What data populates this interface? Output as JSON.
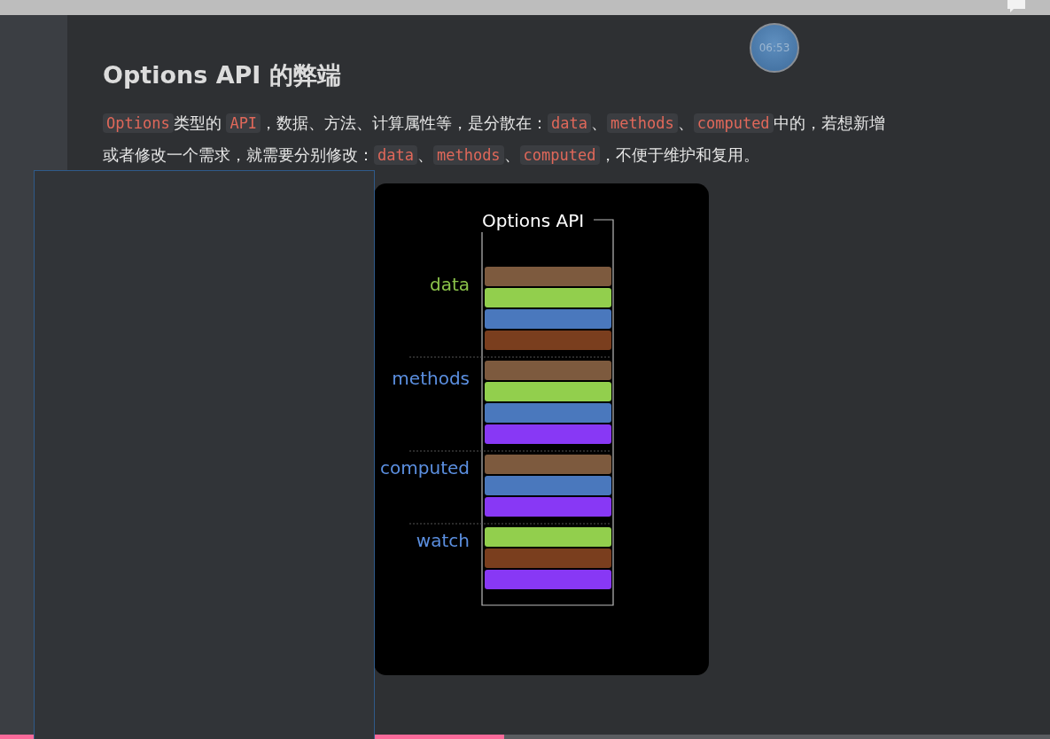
{
  "clock": "06:53",
  "heading": "Options API 的弊端",
  "paragraph": [
    [
      {
        "kind": "code",
        "text": "Options"
      },
      {
        "kind": "text",
        "text": "类型的 "
      },
      {
        "kind": "code",
        "text": "API"
      },
      {
        "kind": "text",
        "text": "，数据、方法、计算属性等，是分散在："
      },
      {
        "kind": "code",
        "text": "data"
      },
      {
        "kind": "text",
        "text": "、"
      },
      {
        "kind": "code",
        "text": "methods"
      },
      {
        "kind": "text",
        "text": "、"
      },
      {
        "kind": "code",
        "text": "computed"
      },
      {
        "kind": "text",
        "text": "中的，若想新增"
      }
    ],
    [
      {
        "kind": "text",
        "text": "或者修改一个需求，就需要分别修改："
      },
      {
        "kind": "code",
        "text": "data"
      },
      {
        "kind": "text",
        "text": "、"
      },
      {
        "kind": "code",
        "text": "methods"
      },
      {
        "kind": "text",
        "text": "、"
      },
      {
        "kind": "code",
        "text": "computed"
      },
      {
        "kind": "text",
        "text": "，不便于维护和复用。"
      }
    ]
  ],
  "diagram": {
    "title": "Options API",
    "groups": [
      {
        "label": "data",
        "color": "#8bc34a",
        "blocks": [
          {
            "color": "#7d5a3e"
          },
          {
            "color": "#92cf4d"
          },
          {
            "color": "#4a78bd"
          },
          {
            "color": "#7a3e1e"
          }
        ]
      },
      {
        "label": "methods",
        "color": "#5b8fe0",
        "blocks": [
          {
            "color": "#7d5a3e"
          },
          {
            "color": "#92cf4d"
          },
          {
            "color": "#4a78bd"
          },
          {
            "color": "#8838f5"
          }
        ]
      },
      {
        "label": "computed",
        "color": "#5b8fe0",
        "blocks": [
          {
            "color": "#7d5a3e"
          },
          {
            "color": "#4a78bd"
          },
          {
            "color": "#8838f5"
          }
        ]
      },
      {
        "label": "watch",
        "color": "#5b8fe0",
        "blocks": [
          {
            "color": "#92cf4d"
          },
          {
            "color": "#7a3e1e"
          },
          {
            "color": "#8838f5"
          }
        ]
      }
    ]
  },
  "progress": {
    "level": 0.48
  }
}
